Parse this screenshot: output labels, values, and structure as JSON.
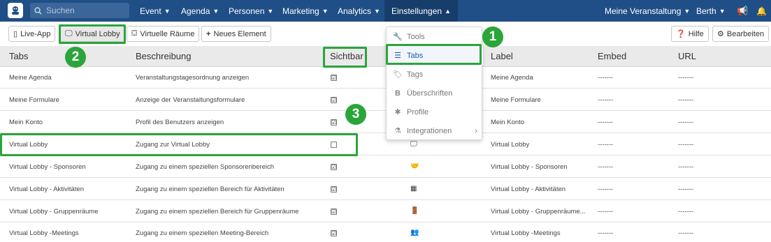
{
  "navbar": {
    "search_placeholder": "Suchen",
    "items": [
      {
        "label": "Event"
      },
      {
        "label": "Agenda"
      },
      {
        "label": "Personen"
      },
      {
        "label": "Marketing"
      },
      {
        "label": "Analytics"
      },
      {
        "label": "Einstellungen"
      },
      {
        "label": "Meine Veranstaltung"
      },
      {
        "label": "Berth"
      }
    ]
  },
  "toolbar": {
    "live_app": "Live-App",
    "virtual_lobby": "Virtual Lobby",
    "virtuelle_raeume": "Virtuelle Räume",
    "neues_element": "Neues Element",
    "hilfe": "Hilfe",
    "bearbeiten": "Bearbeiten"
  },
  "table": {
    "headers": {
      "tabs": "Tabs",
      "beschreibung": "Beschreibung",
      "sichtbar": "Sichtbar",
      "label": "Label",
      "embed": "Embed",
      "url": "URL"
    },
    "rows": [
      {
        "tab": "Meine Agenda",
        "desc": "Veranstaltungstagesordnung anzeigen",
        "visible": "☑",
        "icon": "",
        "label": "Meine Agenda",
        "embed": "-------",
        "url": "-------"
      },
      {
        "tab": "Meine Formulare",
        "desc": "Anzeige der Veranstaltungsformulare",
        "visible": "☑",
        "icon": "",
        "label": "Meine Formulare",
        "embed": "-------",
        "url": "-------"
      },
      {
        "tab": "Mein Konto",
        "desc": "Profil des Benutzers anzeigen",
        "visible": "☑",
        "icon": "",
        "label": "Mein Konto",
        "embed": "-------",
        "url": "-------"
      },
      {
        "tab": "Virtual Lobby",
        "desc": "Zugang zur Virtual Lobby",
        "visible": "",
        "icon": "🖵",
        "label": "Virtual Lobby",
        "embed": "-------",
        "url": "-------"
      },
      {
        "tab": "Virtual Lobby - Sponsoren",
        "desc": "Zugang zu einem speziellen Sponsorenbereich",
        "visible": "☑",
        "icon": "🤝",
        "label": "Virtual Lobby - Sponsoren",
        "embed": "-------",
        "url": "-------"
      },
      {
        "tab": "Virtual Lobby - Aktivitäten",
        "desc": "Zugang zu einem speziellen Bereich für Aktivitäten",
        "visible": "☑",
        "icon": "▦",
        "label": "Virtual Lobby - Aktivitäten",
        "embed": "-------",
        "url": "-------"
      },
      {
        "tab": "Virtual Lobby - Gruppenräume",
        "desc": "Zugang zu einem speziellen Bereich für Gruppenräume",
        "visible": "☑",
        "icon": "🚪",
        "label": "Virtual Lobby - Gruppenräume...",
        "embed": "-------",
        "url": "-------"
      },
      {
        "tab": "Virtual Lobby -Meetings",
        "desc": "Zugang zu einem speziellen Meeting-Bereich",
        "visible": "☑",
        "icon": "👥",
        "label": "Virtual Lobby -Meetings",
        "embed": "-------",
        "url": "-------"
      }
    ]
  },
  "menu": {
    "items": [
      {
        "label": "Tools",
        "icon": "🔧"
      },
      {
        "label": "Tabs",
        "icon": "☰"
      },
      {
        "label": "Tags",
        "icon": "🏷"
      },
      {
        "label": "Überschriften",
        "icon": "B"
      },
      {
        "label": "Profile",
        "icon": "✱"
      },
      {
        "label": "Integrationen",
        "icon": "⚗"
      }
    ]
  },
  "annotations": {
    "n1": "1",
    "n2": "2",
    "n3": "3"
  },
  "colors": {
    "navbar": "#1f4f86",
    "highlight": "#2aa53a",
    "menu_selected": "#1f5ea8"
  }
}
